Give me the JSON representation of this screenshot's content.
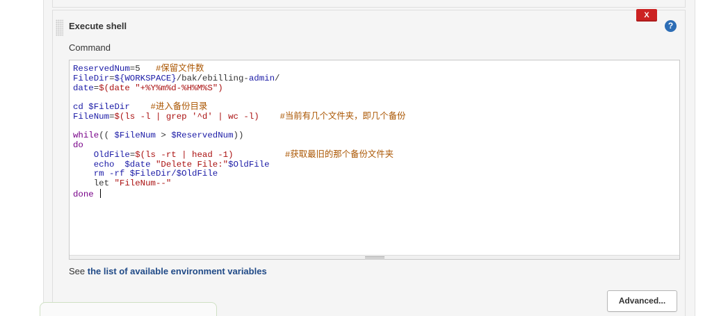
{
  "build_step": {
    "title": "Execute shell",
    "delete_label": "X",
    "help_label": "?",
    "command_label": "Command",
    "command_lines": [
      [
        {
          "t": "v",
          "x": "ReservedNum"
        },
        {
          "t": "d",
          "x": "=5   "
        },
        {
          "t": "c",
          "x": "#保留文件数"
        }
      ],
      [
        {
          "t": "v",
          "x": "FileDir"
        },
        {
          "t": "d",
          "x": "="
        },
        {
          "t": "v",
          "x": "${WORKSPACE}"
        },
        {
          "t": "d",
          "x": "/bak/ebilling-"
        },
        {
          "t": "v",
          "x": "admin"
        },
        {
          "t": "d",
          "x": "/"
        }
      ],
      [
        {
          "t": "v",
          "x": "date"
        },
        {
          "t": "d",
          "x": "="
        },
        {
          "t": "s",
          "x": "$(date \"+%Y%m%d-%H%M%S\")"
        }
      ],
      [],
      [
        {
          "t": "v",
          "x": "cd $FileDir"
        },
        {
          "t": "d",
          "x": "    "
        },
        {
          "t": "c",
          "x": "#进入备份目录"
        }
      ],
      [
        {
          "t": "v",
          "x": "FileNum"
        },
        {
          "t": "d",
          "x": "="
        },
        {
          "t": "s",
          "x": "$(ls -l | grep '^d' | wc -l)"
        },
        {
          "t": "d",
          "x": "    "
        },
        {
          "t": "c",
          "x": "#当前有几个文件夹，即几个备份"
        }
      ],
      [],
      [
        {
          "t": "k",
          "x": "while"
        },
        {
          "t": "d",
          "x": "(( "
        },
        {
          "t": "v",
          "x": "$FileNum"
        },
        {
          "t": "d",
          "x": " > "
        },
        {
          "t": "v",
          "x": "$ReservedNum"
        },
        {
          "t": "d",
          "x": "))"
        }
      ],
      [
        {
          "t": "k",
          "x": "do"
        }
      ],
      [
        {
          "t": "d",
          "x": "    "
        },
        {
          "t": "v",
          "x": "OldFile"
        },
        {
          "t": "d",
          "x": "="
        },
        {
          "t": "s",
          "x": "$(ls -rt | head -1)"
        },
        {
          "t": "d",
          "x": "          "
        },
        {
          "t": "c",
          "x": "#获取最旧的那个备份文件夹"
        }
      ],
      [
        {
          "t": "d",
          "x": "    "
        },
        {
          "t": "v",
          "x": "echo  $date "
        },
        {
          "t": "s",
          "x": "\"Delete File:\""
        },
        {
          "t": "v",
          "x": "$OldFile"
        }
      ],
      [
        {
          "t": "d",
          "x": "    "
        },
        {
          "t": "v",
          "x": "rm -rf $FileDir/$OldFile"
        }
      ],
      [
        {
          "t": "d",
          "x": "    let "
        },
        {
          "t": "s",
          "x": "\"FileNum--\""
        }
      ],
      [
        {
          "t": "k",
          "x": "done"
        },
        {
          "t": "d",
          "x": " "
        }
      ]
    ],
    "env_prefix": "See ",
    "env_link": "the list of available environment variables",
    "advanced_label": "Advanced..."
  },
  "colors": {
    "variable": "#1a1aa6",
    "string": "#aa1111",
    "comment": "#aa5500",
    "keyword": "#770088",
    "delete_button": "#cc2222",
    "help_icon": "#2d6db5",
    "link": "#204a87"
  },
  "icons": {
    "drag_handle": "grip-dots-icon",
    "help": "help-circle-icon",
    "delete": "close-icon"
  }
}
